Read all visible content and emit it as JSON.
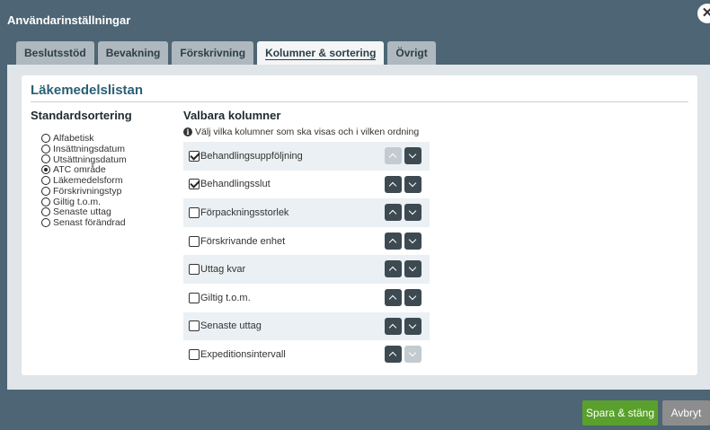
{
  "dialog": {
    "title": "Användarinställningar",
    "close_icon": "close-icon"
  },
  "tabs": [
    {
      "label": "Beslutsstöd",
      "active": false
    },
    {
      "label": "Bevakning",
      "active": false
    },
    {
      "label": "Förskrivning",
      "active": false
    },
    {
      "label": "Kolumner & sortering",
      "active": true
    },
    {
      "label": "Övrigt",
      "active": false
    }
  ],
  "section": {
    "title": "Läkemedelslistan"
  },
  "sorting": {
    "heading": "Standardsortering",
    "options": [
      {
        "label": "Alfabetisk",
        "selected": false
      },
      {
        "label": "Insättningsdatum",
        "selected": false
      },
      {
        "label": "Utsättningsdatum",
        "selected": false
      },
      {
        "label": "ATC område",
        "selected": true
      },
      {
        "label": "Läkemedelsform",
        "selected": false
      },
      {
        "label": "Förskrivningstyp",
        "selected": false
      },
      {
        "label": "Giltig t.o.m.",
        "selected": false
      },
      {
        "label": "Senaste uttag",
        "selected": false
      },
      {
        "label": "Senast förändrad",
        "selected": false
      }
    ]
  },
  "columns": {
    "heading": "Valbara kolumner",
    "info": "Välj vilka kolumner som ska visas och i vilken ordning",
    "items": [
      {
        "label": "Behandlingsuppföljning",
        "checked": true,
        "up_enabled": false,
        "down_enabled": true
      },
      {
        "label": "Behandlingsslut",
        "checked": true,
        "up_enabled": true,
        "down_enabled": true
      },
      {
        "label": "Förpackningsstorlek",
        "checked": false,
        "up_enabled": true,
        "down_enabled": true
      },
      {
        "label": "Förskrivande enhet",
        "checked": false,
        "up_enabled": true,
        "down_enabled": true
      },
      {
        "label": "Uttag kvar",
        "checked": false,
        "up_enabled": true,
        "down_enabled": true
      },
      {
        "label": "Giltig t.o.m.",
        "checked": false,
        "up_enabled": true,
        "down_enabled": true
      },
      {
        "label": "Senaste uttag",
        "checked": false,
        "up_enabled": true,
        "down_enabled": true
      },
      {
        "label": "Expeditionsintervall",
        "checked": false,
        "up_enabled": true,
        "down_enabled": false
      }
    ]
  },
  "footer": {
    "save_label": "Spara & stäng",
    "cancel_label": "Avbryt"
  },
  "colors": {
    "header_bg": "#4d6574",
    "accent": "#2a5f75",
    "save": "#5aa02c",
    "cancel": "#8d8d8d"
  }
}
